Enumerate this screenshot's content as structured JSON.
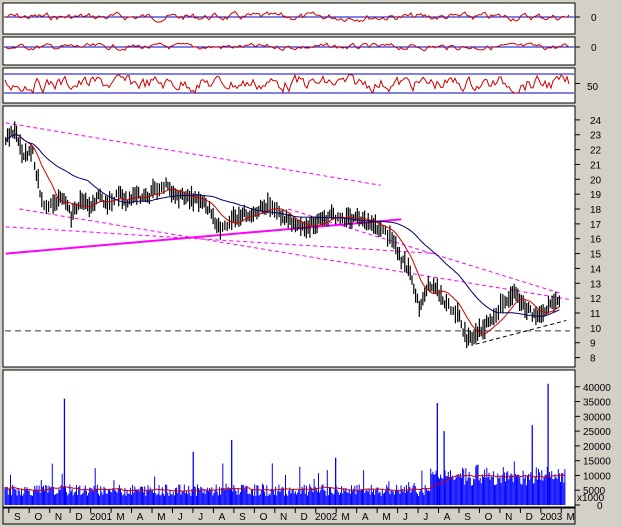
{
  "chart_data": [
    {
      "panel": "indicator-1",
      "type": "line",
      "y_ticks": [
        "0"
      ],
      "line_color": "#cc0000",
      "ref_color": "#0000cc"
    },
    {
      "panel": "indicator-2",
      "type": "line",
      "y_ticks": [
        "0"
      ],
      "line_color": "#cc0000",
      "ref_color": "#0000cc"
    },
    {
      "panel": "indicator-3",
      "type": "line",
      "y_ticks": [
        "50"
      ],
      "line_color": "#cc0000",
      "ref_color": "#0000cc"
    },
    {
      "panel": "price",
      "type": "line",
      "x_range": [
        2000.667,
        2003.167
      ],
      "ylim": [
        7.5,
        24.8
      ],
      "y_ticks": [
        "8",
        "9",
        "10",
        "11",
        "12",
        "13",
        "14",
        "15",
        "16",
        "17",
        "18",
        "19",
        "20",
        "21",
        "22",
        "23",
        "24"
      ],
      "series": [
        {
          "role": "price-bars",
          "color": "#000000",
          "x": [
            2000.67,
            2000.71,
            2000.75,
            2000.79,
            2000.83,
            2000.88,
            2000.92,
            2000.96,
            2001.0,
            2001.04,
            2001.08,
            2001.12,
            2001.17,
            2001.21,
            2001.25,
            2001.29,
            2001.33,
            2001.38,
            2001.42,
            2001.46,
            2001.5,
            2001.54,
            2001.58,
            2001.62,
            2001.67,
            2001.71,
            2001.75,
            2001.79,
            2001.83,
            2001.88,
            2001.92,
            2001.96,
            2002.0,
            2002.04,
            2002.08,
            2002.12,
            2002.17,
            2002.21,
            2002.25,
            2002.29,
            2002.33,
            2002.38,
            2002.42,
            2002.46,
            2002.5,
            2002.54,
            2002.58,
            2002.62,
            2002.67,
            2002.71,
            2002.75,
            2002.79,
            2002.83,
            2002.88,
            2002.92,
            2002.96,
            2003.0,
            2003.04,
            2003.08,
            2003.12
          ],
          "y": [
            22.8,
            23.2,
            21.5,
            21.8,
            18.5,
            18.2,
            18.8,
            17.5,
            18.6,
            18.2,
            18.8,
            18.4,
            19.0,
            18.6,
            18.9,
            18.7,
            19.3,
            19.6,
            18.8,
            18.9,
            18.6,
            18.5,
            17.8,
            16.5,
            17.4,
            17.6,
            17.7,
            18.0,
            18.2,
            17.6,
            17.2,
            16.8,
            16.9,
            17.1,
            17.4,
            17.6,
            17.3,
            17.4,
            17.2,
            16.9,
            16.6,
            16.0,
            14.6,
            13.9,
            11.2,
            12.8,
            12.5,
            11.6,
            11.0,
            9.2,
            9.6,
            10.1,
            10.9,
            11.8,
            12.4,
            11.6,
            10.9,
            11.1,
            11.4,
            11.8
          ]
        },
        {
          "role": "moving-average-short",
          "color": "#cc0000"
        },
        {
          "role": "moving-average-long",
          "color": "#000066"
        }
      ],
      "annotations": [
        {
          "kind": "trendline",
          "color": "#ff00ff",
          "from": [
            2000.67,
            15.0
          ],
          "to": [
            2002.42,
            17.3
          ]
        },
        {
          "kind": "channel-line",
          "style": "dashed",
          "color": "#ff00ff",
          "from": [
            2000.67,
            23.8
          ],
          "to": [
            2002.33,
            19.6
          ]
        },
        {
          "kind": "channel-line",
          "style": "dashed",
          "color": "#ff00ff",
          "from": [
            2000.67,
            16.8
          ],
          "to": [
            2002.58,
            15.0
          ]
        },
        {
          "kind": "channel-line",
          "style": "dashed",
          "color": "#ff00ff",
          "from": [
            2000.73,
            18.0
          ],
          "to": [
            2003.17,
            11.9
          ]
        },
        {
          "kind": "channel-line",
          "style": "dashed",
          "color": "#ff00ff",
          "from": [
            2001.92,
            18.0
          ],
          "to": [
            2003.13,
            12.3
          ]
        },
        {
          "kind": "horizontal-level",
          "style": "dashed",
          "color": "#333333",
          "y": 9.8
        },
        {
          "kind": "support-line",
          "style": "dashed",
          "color": "#000000",
          "from": [
            2002.75,
            8.9
          ],
          "to": [
            2003.15,
            10.5
          ]
        }
      ]
    },
    {
      "panel": "volume",
      "type": "bar",
      "ylim": [
        0,
        45000
      ],
      "y_ticks": [
        "40000",
        "35000",
        "30000",
        "25000",
        "20000",
        "15000",
        "10000",
        "5000",
        "0"
      ],
      "unit_label": "x1000",
      "bar_color": "#0000ff",
      "average_color": "#cc0000",
      "spikes": [
        {
          "x": 2000.93,
          "y": 36000
        },
        {
          "x": 2001.67,
          "y": 22000
        },
        {
          "x": 2002.58,
          "y": 34500
        },
        {
          "x": 2002.61,
          "y": 25000
        },
        {
          "x": 2003.07,
          "y": 41000
        },
        {
          "x": 2003.0,
          "y": 27000
        },
        {
          "x": 2001.5,
          "y": 18000
        },
        {
          "x": 2002.13,
          "y": 16000
        }
      ]
    }
  ],
  "x_axis": {
    "labels": [
      "S",
      "O",
      "N",
      "D",
      "2001",
      "M",
      "A",
      "M",
      "J",
      "J",
      "A",
      "S",
      "O",
      "N",
      "D",
      "2002",
      "M",
      "A",
      "M",
      "J",
      "J",
      "A",
      "S",
      "O",
      "N",
      "D",
      "2003",
      "M"
    ]
  },
  "colors": {
    "panel_bg": "#ffffff",
    "frame_bg": "#d4d0c8",
    "trendline": "#ff00ff"
  }
}
